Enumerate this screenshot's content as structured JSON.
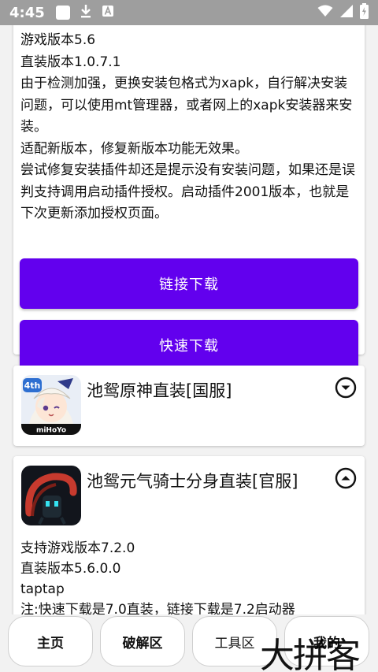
{
  "status_bar": {
    "time": "4:45",
    "icons": [
      "square-notification-icon",
      "download-icon",
      "a-icon",
      "wifi-icon",
      "signal-icon",
      "battery-icon"
    ]
  },
  "card1": {
    "lines": [
      "游戏版本5.6",
      "直装版本1.0.7.1",
      "由于检测加强，更换安装包格式为xapk，自行解决安装问题，可以使用mt管理器，或者网上的xapk安装器来安装。",
      "适配新版本，修复新版本功能无效果。",
      "尝试修复安装插件却还是提示没有安装问题，如果还是误判支持调用启动插件授权。启动插件2001版本，也就是下次更新添加授权页面。"
    ],
    "link_download": "链接下载",
    "fast_download": "快速下载"
  },
  "card2": {
    "title": "池鸳原神直装[国服]",
    "icon_badge": "4th",
    "icon_brand": "miHoYo",
    "state": "collapsed"
  },
  "card3": {
    "title": "池鸳元气骑士分身直装[官服]",
    "state": "expanded",
    "lines": [
      "支持游戏版本7.2.0",
      "直装版本5.6.0.0",
      "taptap",
      "注:快速下载是7.0直装，链接下载是7.2启动器"
    ]
  },
  "bottom_nav": {
    "items": [
      "主页",
      "破解区",
      "工具区",
      "我的"
    ]
  },
  "watermark": "大拼客",
  "colors": {
    "accent": "#6200ee",
    "status_bar": "#9e9e9e",
    "background": "#f2f2f2"
  }
}
